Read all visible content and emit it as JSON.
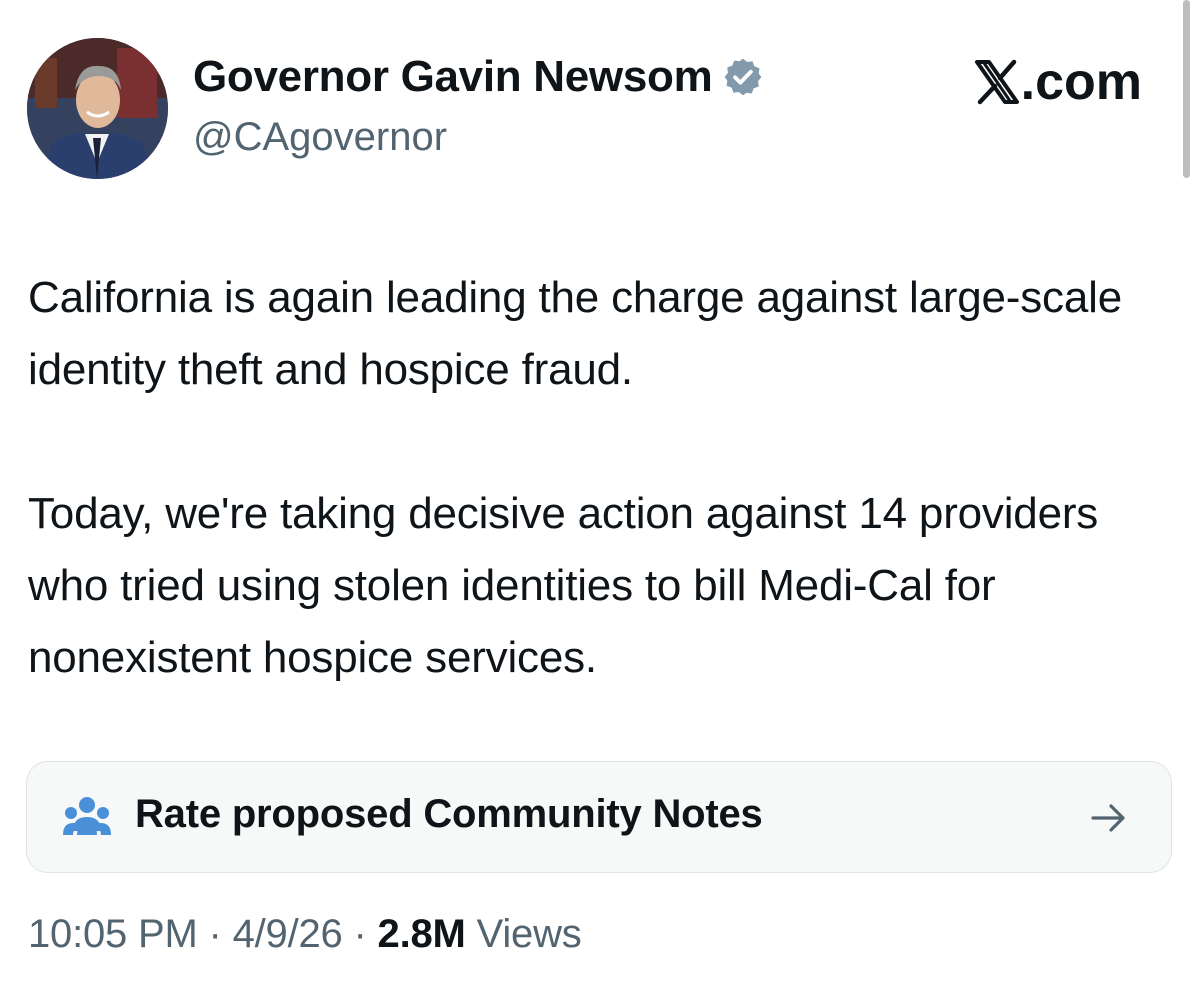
{
  "author": {
    "display_name": "Governor Gavin Newsom",
    "handle": "@CAgovernor",
    "verified_icon": "verified-badge-icon",
    "avatar_icon": "avatar-photo"
  },
  "brand": {
    "logo_icon": "x-logo-icon",
    "suffix": ".com"
  },
  "tweet": {
    "text": "California is again leading the charge against large-scale identity theft and hospice fraud.\n\nToday, we're taking decisive action against 14 providers who tried using stolen identities to bill Medi-Cal for nonexistent hospice services."
  },
  "community_notes": {
    "label": "Rate proposed Community Notes",
    "icon": "people-icon",
    "arrow_icon": "arrow-right-icon",
    "icon_color": "#4a90d9"
  },
  "meta": {
    "time": "10:05 PM",
    "separator": " · ",
    "date": "4/9/26",
    "views_count": "2.8M",
    "views_label": " Views"
  },
  "colors": {
    "text": "#0f1419",
    "secondary": "#536471",
    "verified_badge": "#829aab",
    "card_background": "#f7f9f9",
    "card_border": "#dfe3e7"
  }
}
